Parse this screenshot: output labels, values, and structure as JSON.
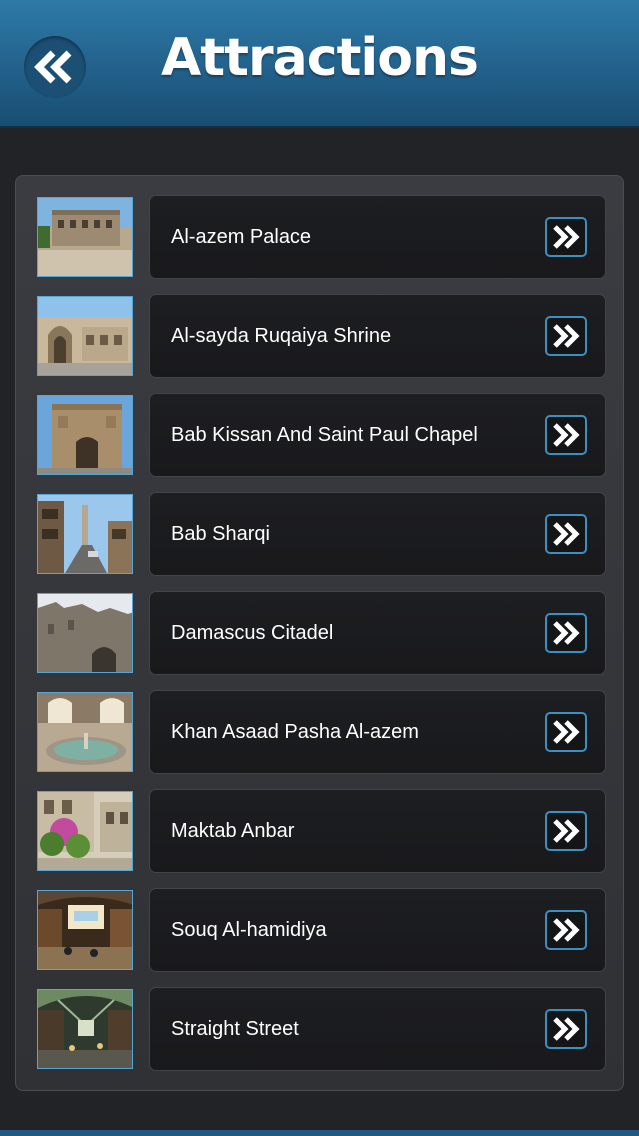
{
  "header": {
    "title": "Attractions",
    "back_icon": "double-chevron-left-icon"
  },
  "colors": {
    "header_top": "#2e7aa8",
    "header_bottom": "#184d72",
    "accent_border": "#3d8fc0",
    "row_bg": "#1b1c1f",
    "panel_bg": "#35373b"
  },
  "attractions": [
    {
      "label": "Al-azem Palace",
      "icon": "double-chevron-right-icon"
    },
    {
      "label": "Al-sayda Ruqaiya Shrine",
      "icon": "double-chevron-right-icon"
    },
    {
      "label": "Bab Kissan And Saint Paul Chapel",
      "icon": "double-chevron-right-icon"
    },
    {
      "label": "Bab Sharqi",
      "icon": "double-chevron-right-icon"
    },
    {
      "label": "Damascus Citadel",
      "icon": "double-chevron-right-icon"
    },
    {
      "label": "Khan Asaad Pasha Al-azem",
      "icon": "double-chevron-right-icon"
    },
    {
      "label": "Maktab Anbar",
      "icon": "double-chevron-right-icon"
    },
    {
      "label": "Souq Al-hamidiya",
      "icon": "double-chevron-right-icon"
    },
    {
      "label": "Straight Street",
      "icon": "double-chevron-right-icon"
    }
  ]
}
